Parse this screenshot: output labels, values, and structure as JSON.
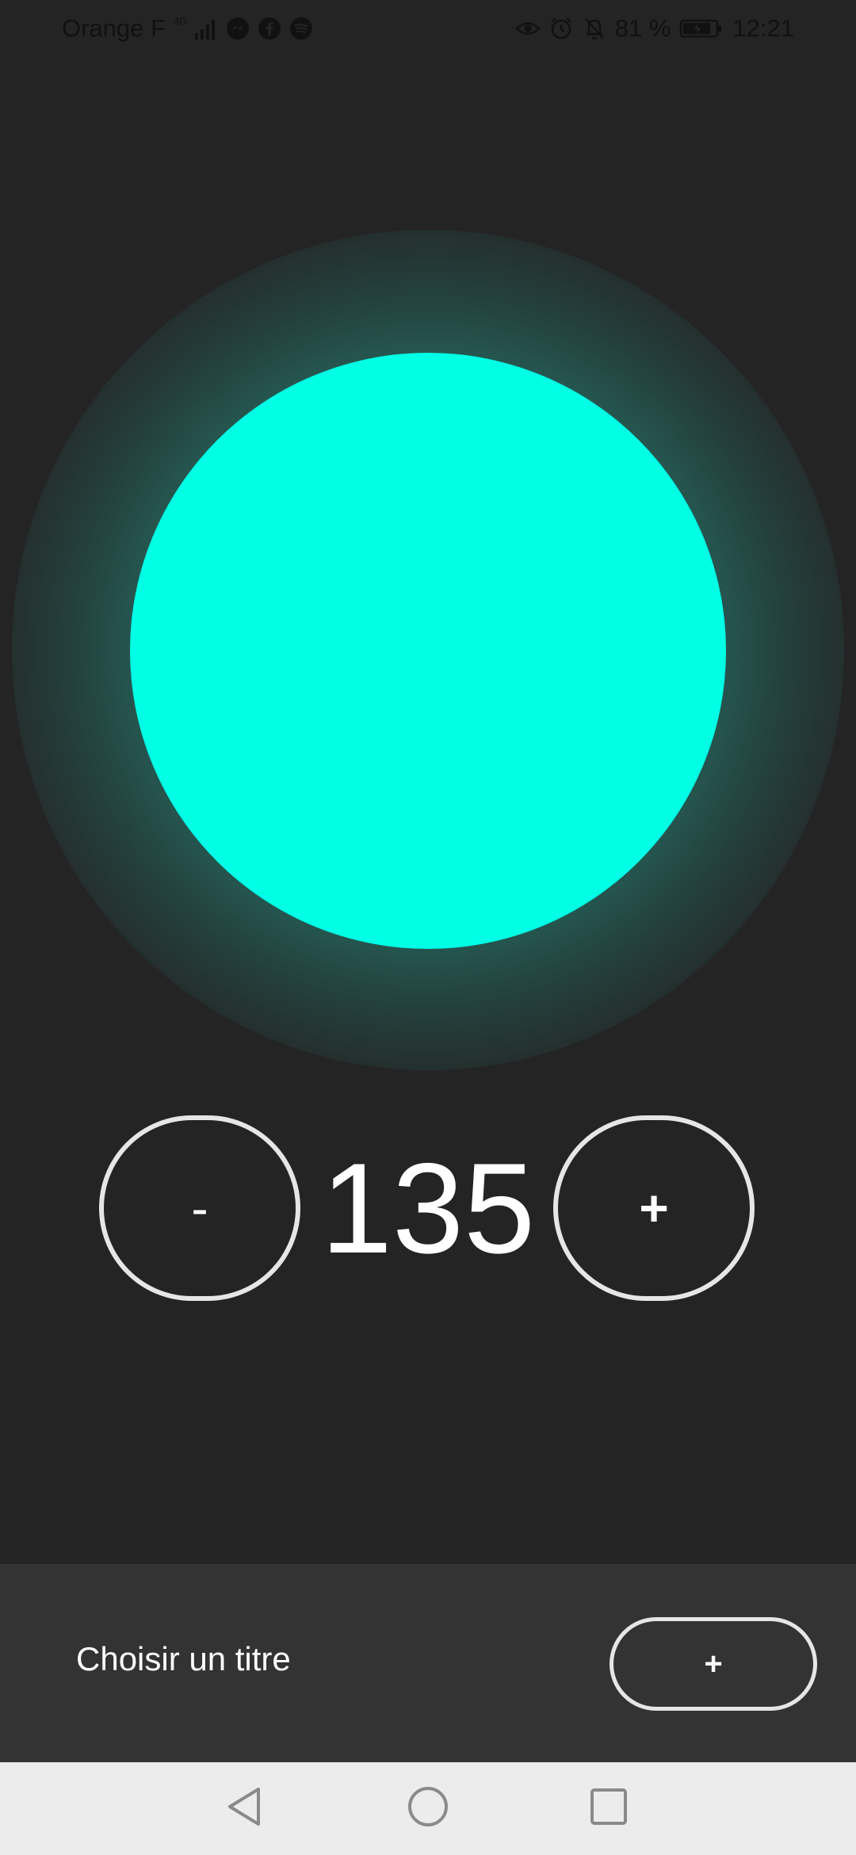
{
  "status_bar": {
    "carrier": "Orange F",
    "network_type": "4G",
    "battery_percent": "81 %",
    "time": "12:21",
    "left_icons": [
      "signal-icon",
      "messenger-icon",
      "facebook-icon",
      "spotify-icon"
    ],
    "right_icons": [
      "eye-icon",
      "alarm-icon",
      "bell-off-icon",
      "battery-icon"
    ]
  },
  "orb": {
    "color": "#00ffe5",
    "glow_color": "#2a6e64"
  },
  "counter": {
    "decrement_label": "-",
    "value": "135",
    "increment_label": "+"
  },
  "bottom_panel": {
    "title_label": "Choisir un titre",
    "add_button_label": "+"
  },
  "nav_bar": {
    "buttons": [
      "back-icon",
      "home-icon",
      "recents-icon"
    ]
  },
  "colors": {
    "background": "#242424",
    "panel": "#333333",
    "nav_bar": "#ececec",
    "accent": "#00ffe5",
    "button_border": "#e6e6e6"
  }
}
